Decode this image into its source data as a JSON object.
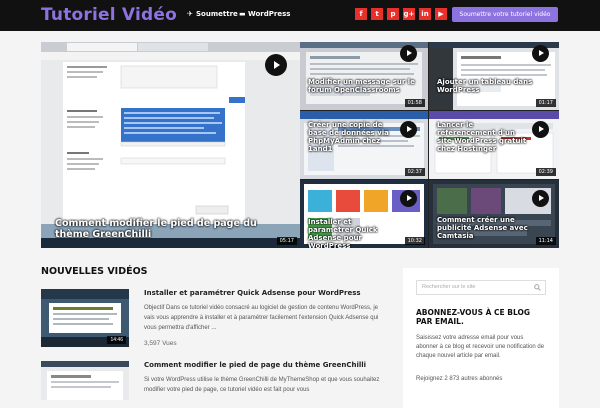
{
  "header": {
    "logo": "Tutoriel Vidéo",
    "nav": [
      {
        "label": "Soumettre",
        "icon": "rocket-icon"
      },
      {
        "label": "WordPress",
        "icon": "monitor-icon"
      }
    ],
    "social": [
      {
        "name": "facebook-icon",
        "glyph": "f"
      },
      {
        "name": "twitter-icon",
        "glyph": "t"
      },
      {
        "name": "pinterest-icon",
        "glyph": "p"
      },
      {
        "name": "google-plus-icon",
        "glyph": "g+"
      },
      {
        "name": "linkedin-icon",
        "glyph": "in"
      },
      {
        "name": "youtube-icon",
        "glyph": "▶"
      }
    ],
    "submit_label": "Soumettre votre tutoriel vidéo",
    "accent": "#8d73e0",
    "social_color": "#e8302b"
  },
  "gallery": {
    "main": {
      "title": "Comment modifier le pied de page du thème GreenChilli",
      "duration": "05:17"
    },
    "tiles": [
      {
        "title": "Modifier un message sur le forum OpenClassrooms",
        "duration": "01:58"
      },
      {
        "title": "Ajouter un tableau dans WordPress",
        "duration": "01:17"
      },
      {
        "title": "Créer une copie de base de données via PhpMyAdmin chez 1and1",
        "duration": "02:37"
      },
      {
        "title": "Lancer le référencement d'un site WordPress gratuit chez Hostinger",
        "duration": "02:39"
      },
      {
        "title": "Installer et paramétrer Quick Adsense pour WordPress",
        "duration": "10:32"
      },
      {
        "title": "Comment créer une publicité Adsense avec Camtasia",
        "duration": "11:14"
      }
    ]
  },
  "section_title": "NOUVELLES VIDÉOS",
  "posts": [
    {
      "title": "Installer et paramétrer Quick Adsense pour WordPress",
      "excerpt": "Objectif Dans ce tutoriel vidéo consacré au logiciel de gestion de contenu WordPress, je vais vous apprendre à installer et à paramétrer facilement l'extension Quick Adsense qui vous permettra d'afficher ...",
      "views": "3,597 Vues",
      "duration": "14:46",
      "thumb_text": "Installer et paramétrer Quick Adsense pour WordPress"
    },
    {
      "title": "Comment modifier le pied de page du thème GreenChilli",
      "excerpt": "Si votre WordPress utilise le thème GreenChilli de MyThemeShop et que vous souhaitez modifier votre pied de page, ce tutoriel vidéo est fait pour vous",
      "views": "",
      "duration": "",
      "thumb_text": "Comment modifier le pied de page du thème GreenChilli"
    }
  ],
  "sidebar": {
    "search_placeholder": "Rechercher sur le site",
    "subscribe_title": "ABONNEZ-VOUS À CE BLOG PAR EMAIL.",
    "subscribe_text": "Saisissez votre adresse email pour vous abonner à ce blog et recevoir une notification de chaque nouvel article par email.",
    "subscribers": "Rejoignez 2 873 autres abonnés"
  }
}
